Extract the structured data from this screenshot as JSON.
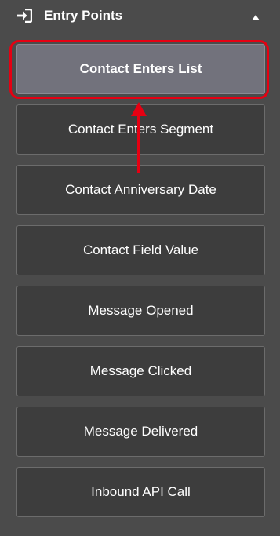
{
  "section": {
    "title": "Entry Points",
    "icon": "sign-in-icon",
    "collapse_icon": "caret-up-icon"
  },
  "entry_points": [
    {
      "label": "Contact Enters List",
      "selected": true
    },
    {
      "label": "Contact Enters Segment",
      "selected": false
    },
    {
      "label": "Contact Anniversary Date",
      "selected": false
    },
    {
      "label": "Contact Field Value",
      "selected": false
    },
    {
      "label": "Message Opened",
      "selected": false
    },
    {
      "label": "Message Clicked",
      "selected": false
    },
    {
      "label": "Message Delivered",
      "selected": false
    },
    {
      "label": "Inbound API Call",
      "selected": false
    }
  ],
  "colors": {
    "panel_bg": "#4b4b4b",
    "button_bg": "#3d3d3d",
    "selected_bg": "#72727c",
    "annotation_red": "#e60012"
  }
}
